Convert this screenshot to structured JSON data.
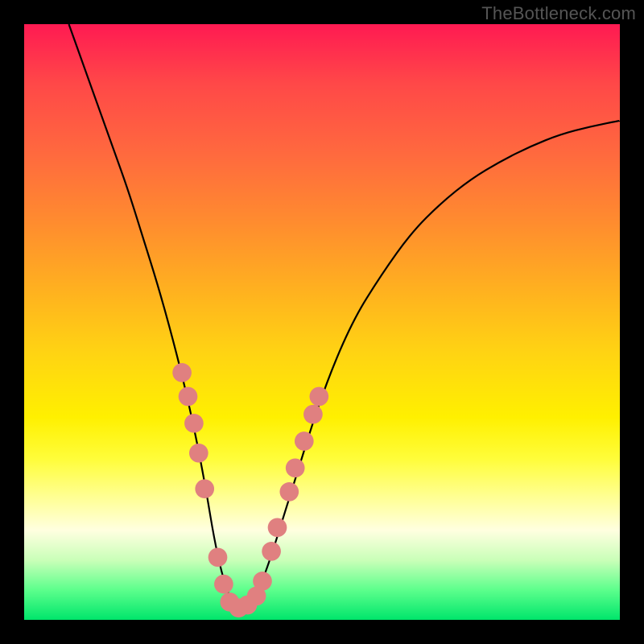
{
  "watermark_text": "TheBottleneck.com",
  "chart_data": {
    "type": "line",
    "title": "",
    "xlabel": "",
    "ylabel": "",
    "xlim": [
      0,
      1
    ],
    "ylim": [
      0,
      1
    ],
    "series": [
      {
        "name": "curve",
        "x": [
          0.075,
          0.1,
          0.125,
          0.15,
          0.175,
          0.2,
          0.225,
          0.25,
          0.275,
          0.3,
          0.325,
          0.35,
          0.375,
          0.4,
          0.45,
          0.5,
          0.55,
          0.6,
          0.65,
          0.7,
          0.75,
          0.8,
          0.85,
          0.9,
          0.95,
          1.0
        ],
        "y": [
          1.0,
          0.93,
          0.86,
          0.79,
          0.72,
          0.64,
          0.56,
          0.47,
          0.37,
          0.25,
          0.1,
          0.02,
          0.02,
          0.06,
          0.22,
          0.38,
          0.5,
          0.58,
          0.65,
          0.7,
          0.74,
          0.77,
          0.795,
          0.815,
          0.828,
          0.838
        ]
      }
    ],
    "markers": {
      "name": "dots",
      "color": "#e08080",
      "radius_norm": 0.016,
      "points": [
        {
          "x": 0.265,
          "y": 0.415
        },
        {
          "x": 0.275,
          "y": 0.375
        },
        {
          "x": 0.285,
          "y": 0.33
        },
        {
          "x": 0.293,
          "y": 0.28
        },
        {
          "x": 0.303,
          "y": 0.22
        },
        {
          "x": 0.325,
          "y": 0.105
        },
        {
          "x": 0.335,
          "y": 0.06
        },
        {
          "x": 0.345,
          "y": 0.03
        },
        {
          "x": 0.36,
          "y": 0.02
        },
        {
          "x": 0.375,
          "y": 0.025
        },
        {
          "x": 0.39,
          "y": 0.04
        },
        {
          "x": 0.4,
          "y": 0.065
        },
        {
          "x": 0.415,
          "y": 0.115
        },
        {
          "x": 0.425,
          "y": 0.155
        },
        {
          "x": 0.445,
          "y": 0.215
        },
        {
          "x": 0.455,
          "y": 0.255
        },
        {
          "x": 0.47,
          "y": 0.3
        },
        {
          "x": 0.485,
          "y": 0.345
        },
        {
          "x": 0.495,
          "y": 0.375
        }
      ]
    },
    "background_gradient": {
      "direction": "vertical",
      "stops": [
        {
          "pos": 0.0,
          "color": "#ff1a52"
        },
        {
          "pos": 0.33,
          "color": "#ff8b2f"
        },
        {
          "pos": 0.66,
          "color": "#fff000"
        },
        {
          "pos": 0.85,
          "color": "#ffffe0"
        },
        {
          "pos": 1.0,
          "color": "#00e56b"
        }
      ]
    }
  }
}
